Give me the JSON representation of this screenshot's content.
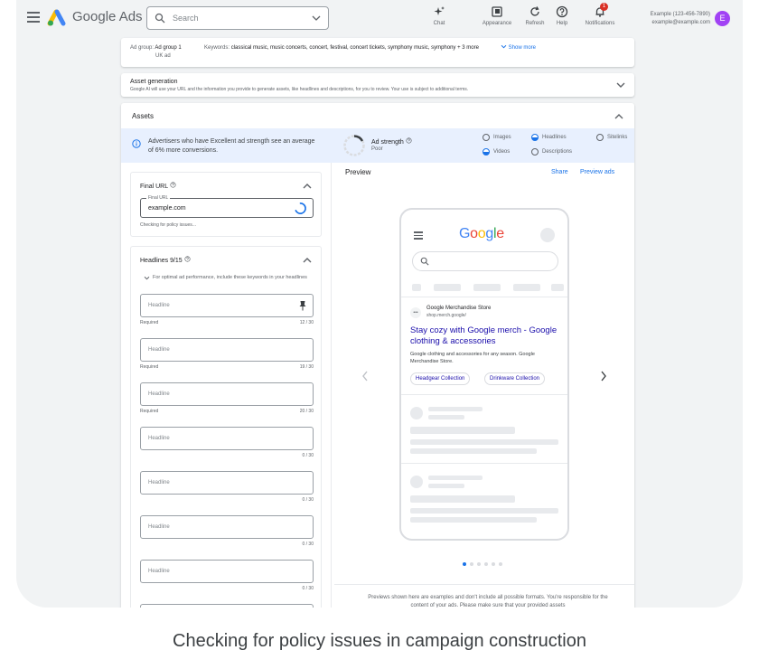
{
  "topbar": {
    "brand": "Google Ads",
    "search_placeholder": "Search",
    "tools": [
      {
        "label": "Chat",
        "icon": "sparkle-icon"
      },
      {
        "label": "Appearance",
        "icon": "appearance-icon"
      },
      {
        "label": "Refresh",
        "icon": "refresh-icon"
      },
      {
        "label": "Help",
        "icon": "help-icon"
      },
      {
        "label": "Notifications",
        "icon": "bell-icon",
        "badge": "1"
      }
    ],
    "account_line1": "Example (123-456-7890)",
    "account_line2": "example@example.com",
    "avatar_letter": "E"
  },
  "ad_group": {
    "label": "Ad group:",
    "name": "Ad group 1",
    "sub": "UK ad",
    "keywords_label": "Keywords:",
    "keywords": "classical music, music concerts, concert, festival, concert tickets, symphony music, symphony + 3 more",
    "show_more": "Show more"
  },
  "asset_generation": {
    "title": "Asset generation",
    "description": "Google AI will use your URL and the information you provide to generate assets, like headlines and descriptions, for you to review. Your use is subject to additional terms."
  },
  "assets": {
    "title": "Assets",
    "banner_text": "Advertisers who have Excellent ad strength see an average of 6% more conversions.",
    "strength_title": "Ad strength",
    "strength_value": "Poor",
    "options": [
      "Images",
      "Headlines",
      "Sitelinks",
      "Videos",
      "Descriptions"
    ]
  },
  "final_url": {
    "title": "Final URL",
    "field_label": "Final URL",
    "value": "example.com",
    "status": "Checking for policy issues..."
  },
  "headlines": {
    "title": "Headlines 9/15",
    "hint": "For optimal ad performance, include these keywords in your headlines",
    "placeholder": "Headline",
    "required": "Required",
    "counts": [
      "12 / 30",
      "19 / 30",
      "20 / 30",
      "0 / 30",
      "0 / 30",
      "0 / 30",
      "0 / 30"
    ]
  },
  "preview": {
    "title": "Preview",
    "share": "Share",
    "preview_ads": "Preview ads",
    "google": "Google",
    "store": "Google Merchandise Store",
    "store_url": "shop.merch.google/",
    "headline": "Stay cozy with Google merch - Google clothing & accessories",
    "description": "Google clothing and accessories for any season. Google Merchandise Store.",
    "chips": [
      "Headgear Collection",
      "Drinkware Collection"
    ],
    "note": "Previews shown here are examples and don't include all possible formats. You're responsible for the content of your ads. Please make sure that your provided assets"
  },
  "caption": "Checking for policy issues in campaign construction"
}
